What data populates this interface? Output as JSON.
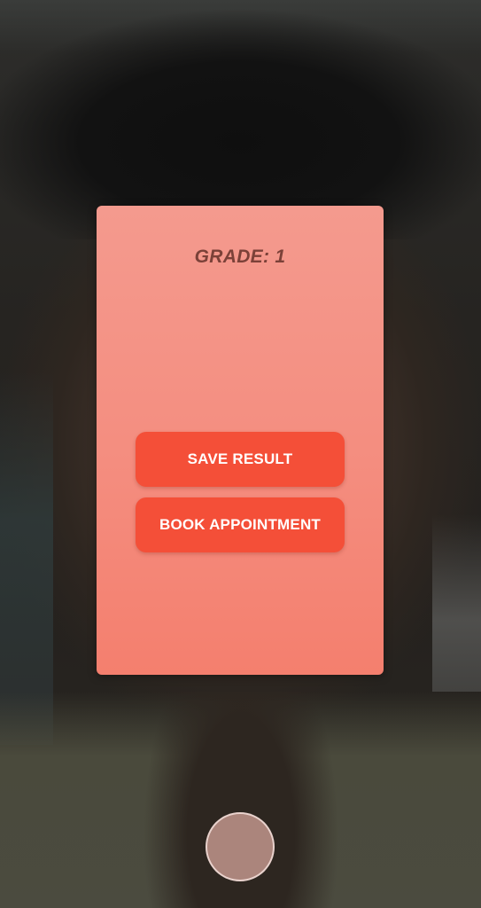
{
  "result_card": {
    "grade_text": "GRADE: 1",
    "save_button_label": "SAVE RESULT",
    "book_button_label": "BOOK APPOINTMENT"
  },
  "camera": {
    "shutter_icon": "circle-shutter-icon"
  },
  "colors": {
    "card_top": "#f49a8e",
    "card_bottom": "#f47f6e",
    "button": "#f44f38",
    "grade_text": "#7b4138"
  }
}
